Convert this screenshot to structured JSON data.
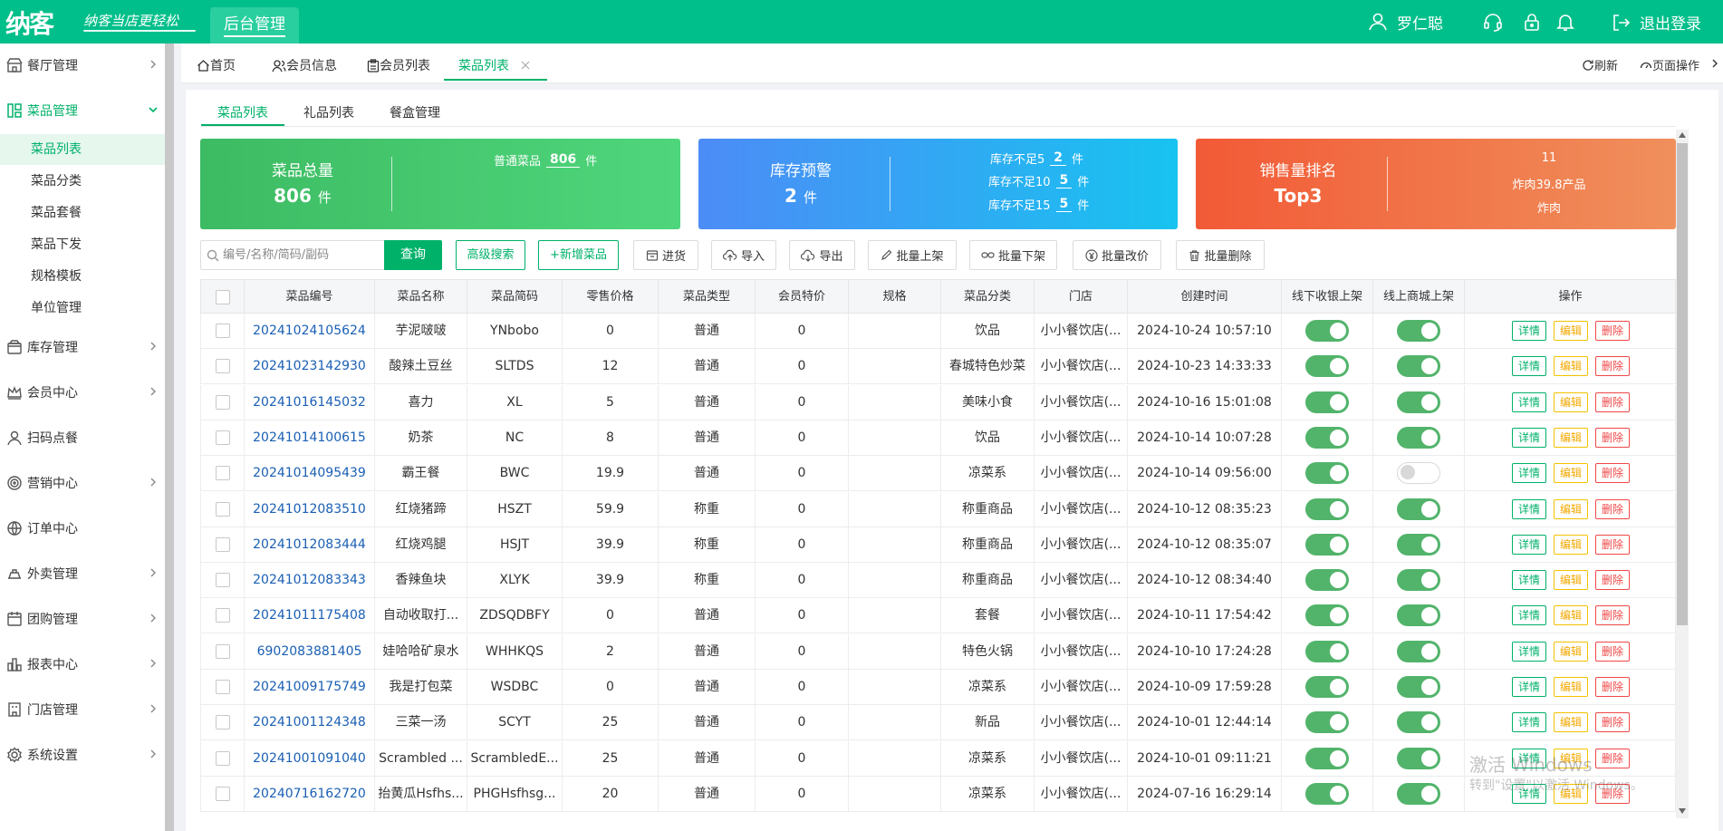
{
  "header": {
    "logo": "纳客",
    "slogan": "纳客当店更轻松",
    "backend_tab": "后台管理",
    "user_name": "罗仁聪",
    "logout": "退出登录"
  },
  "sidebar": {
    "items": [
      {
        "label": "餐厅管理",
        "icon": "store-icon"
      },
      {
        "label": "菜品管理",
        "icon": "grid-icon"
      },
      {
        "label": "库存管理",
        "icon": "box-icon"
      },
      {
        "label": "会员中心",
        "icon": "crown-icon"
      },
      {
        "label": "扫码点餐",
        "icon": "user-icon"
      },
      {
        "label": "营销中心",
        "icon": "target-icon"
      },
      {
        "label": "订单中心",
        "icon": "globe-icon"
      },
      {
        "label": "外卖管理",
        "icon": "delivery-icon"
      },
      {
        "label": "团购管理",
        "icon": "calendar-icon"
      },
      {
        "label": "报表中心",
        "icon": "bar-chart-icon"
      },
      {
        "label": "门店管理",
        "icon": "shop-icon"
      },
      {
        "label": "系统设置",
        "icon": "gear-icon"
      }
    ],
    "sub_items": [
      "菜品列表",
      "菜品分类",
      "菜品套餐",
      "菜品下发",
      "规格模板",
      "单位管理"
    ]
  },
  "page_tabs": [
    "首页",
    "会员信息",
    "会员列表",
    "菜品列表"
  ],
  "toolbar_right": {
    "refresh": "刷新",
    "page_ops": "页面操作"
  },
  "sub_tabs": [
    "菜品列表",
    "礼品列表",
    "餐盒管理"
  ],
  "cards": {
    "total": {
      "title": "菜品总量",
      "value": "806",
      "unit": "件",
      "line_label": "普通菜品",
      "line_value": "806",
      "line_unit": "件",
      "color_from": "#3dbb63",
      "color_to": "#4fd67c"
    },
    "stock": {
      "title": "库存预警",
      "value": "2",
      "unit": "件",
      "lines": [
        {
          "label": "库存不足5",
          "value": "2",
          "unit": "件"
        },
        {
          "label": "库存不足10",
          "value": "5",
          "unit": "件"
        },
        {
          "label": "库存不足15",
          "value": "5",
          "unit": "件"
        }
      ],
      "color_from": "#4c8cf6",
      "color_to": "#18c3f0"
    },
    "sales": {
      "title": "销售量排名",
      "value": "Top3",
      "lines": [
        "11",
        "炸肉39.8产品",
        "炸肉"
      ],
      "color_from": "#f25a36",
      "color_to": "#f0905c"
    }
  },
  "search": {
    "placeholder": "编号/名称/简码/副码",
    "query": "查询",
    "advanced": "高级搜索",
    "add": "+新增菜品"
  },
  "actions": [
    "进货",
    "导入",
    "导出",
    "批量上架",
    "批量下架",
    "批量改价",
    "批量删除"
  ],
  "table": {
    "headers": [
      "菜品编号",
      "菜品名称",
      "菜品简码",
      "零售价格",
      "菜品类型",
      "会员特价",
      "规格",
      "菜品分类",
      "门店",
      "创建时间",
      "线下收银上架",
      "线上商城上架",
      "操作"
    ],
    "row_buttons": {
      "detail": "详情",
      "edit": "编辑",
      "delete": "删除"
    },
    "rows": [
      {
        "code": "20241024105624",
        "name": "芋泥啵啵",
        "abbr": "YNbobo",
        "price": "0",
        "type": "普通",
        "member_price": "0",
        "spec": "",
        "category": "饮品",
        "store": "小小餐饮店(...",
        "created": "2024-10-24 10:57:10",
        "offline_on": true,
        "online_on": true
      },
      {
        "code": "20241023142930",
        "name": "酸辣土豆丝",
        "abbr": "SLTDS",
        "price": "12",
        "type": "普通",
        "member_price": "0",
        "spec": "",
        "category": "春城特色炒菜",
        "store": "小小餐饮店(...",
        "created": "2024-10-23 14:33:33",
        "offline_on": true,
        "online_on": true
      },
      {
        "code": "20241016145032",
        "name": "喜力",
        "abbr": "XL",
        "price": "5",
        "type": "普通",
        "member_price": "0",
        "spec": "",
        "category": "美味小食",
        "store": "小小餐饮店(...",
        "created": "2024-10-16 15:01:08",
        "offline_on": true,
        "online_on": true
      },
      {
        "code": "20241014100615",
        "name": "奶茶",
        "abbr": "NC",
        "price": "8",
        "type": "普通",
        "member_price": "0",
        "spec": "",
        "category": "饮品",
        "store": "小小餐饮店(...",
        "created": "2024-10-14 10:07:28",
        "offline_on": true,
        "online_on": true
      },
      {
        "code": "20241014095439",
        "name": "霸王餐",
        "abbr": "BWC",
        "price": "19.9",
        "type": "普通",
        "member_price": "0",
        "spec": "",
        "category": "凉菜系",
        "store": "小小餐饮店(...",
        "created": "2024-10-14 09:56:00",
        "offline_on": true,
        "online_on": false
      },
      {
        "code": "20241012083510",
        "name": "红烧猪蹄",
        "abbr": "HSZT",
        "price": "59.9",
        "type": "称重",
        "member_price": "0",
        "spec": "",
        "category": "称重商品",
        "store": "小小餐饮店(...",
        "created": "2024-10-12 08:35:23",
        "offline_on": true,
        "online_on": true
      },
      {
        "code": "20241012083444",
        "name": "红烧鸡腿",
        "abbr": "HSJT",
        "price": "39.9",
        "type": "称重",
        "member_price": "0",
        "spec": "",
        "category": "称重商品",
        "store": "小小餐饮店(...",
        "created": "2024-10-12 08:35:07",
        "offline_on": true,
        "online_on": true
      },
      {
        "code": "20241012083343",
        "name": "香辣鱼块",
        "abbr": "XLYK",
        "price": "39.9",
        "type": "称重",
        "member_price": "0",
        "spec": "",
        "category": "称重商品",
        "store": "小小餐饮店(...",
        "created": "2024-10-12 08:34:40",
        "offline_on": true,
        "online_on": true
      },
      {
        "code": "20241011175408",
        "name": "自动收取打...",
        "abbr": "ZDSQDBFY",
        "price": "0",
        "type": "普通",
        "member_price": "0",
        "spec": "",
        "category": "套餐",
        "store": "小小餐饮店(...",
        "created": "2024-10-11 17:54:42",
        "offline_on": true,
        "online_on": true
      },
      {
        "code": "6902083881405",
        "name": "娃哈哈矿泉水",
        "abbr": "WHHKQS",
        "price": "2",
        "type": "普通",
        "member_price": "0",
        "spec": "",
        "category": "特色火锅",
        "store": "小小餐饮店(...",
        "created": "2024-10-10 17:24:28",
        "offline_on": true,
        "online_on": true
      },
      {
        "code": "20241009175749",
        "name": "我是打包菜",
        "abbr": "WSDBC",
        "price": "0",
        "type": "普通",
        "member_price": "0",
        "spec": "",
        "category": "凉菜系",
        "store": "小小餐饮店(...",
        "created": "2024-10-09 17:59:28",
        "offline_on": true,
        "online_on": true
      },
      {
        "code": "20241001124348",
        "name": "三菜一汤",
        "abbr": "SCYT",
        "price": "25",
        "type": "普通",
        "member_price": "0",
        "spec": "",
        "category": "新品",
        "store": "小小餐饮店(...",
        "created": "2024-10-01 12:44:14",
        "offline_on": true,
        "online_on": true
      },
      {
        "code": "20241001091040",
        "name": "Scrambled ...",
        "abbr": "ScrambledE...",
        "price": "25",
        "type": "普通",
        "member_price": "0",
        "spec": "",
        "category": "凉菜系",
        "store": "小小餐饮店(...",
        "created": "2024-10-01 09:11:21",
        "offline_on": true,
        "online_on": true
      },
      {
        "code": "20240716162720",
        "name": "抬黄瓜Hsfhs...",
        "abbr": "PHGHsfhsg...",
        "price": "20",
        "type": "普通",
        "member_price": "0",
        "spec": "",
        "category": "凉菜系",
        "store": "小小餐饮店(...",
        "created": "2024-07-16 16:29:14",
        "offline_on": true,
        "online_on": true
      }
    ]
  },
  "watermark": {
    "line1": "激活 Windows",
    "line2": "转到\"设置\"以激活 Windows。"
  },
  "colors": {
    "brand": "#00bf8a",
    "accent": "#00b16a",
    "link": "#1a5fb4"
  }
}
